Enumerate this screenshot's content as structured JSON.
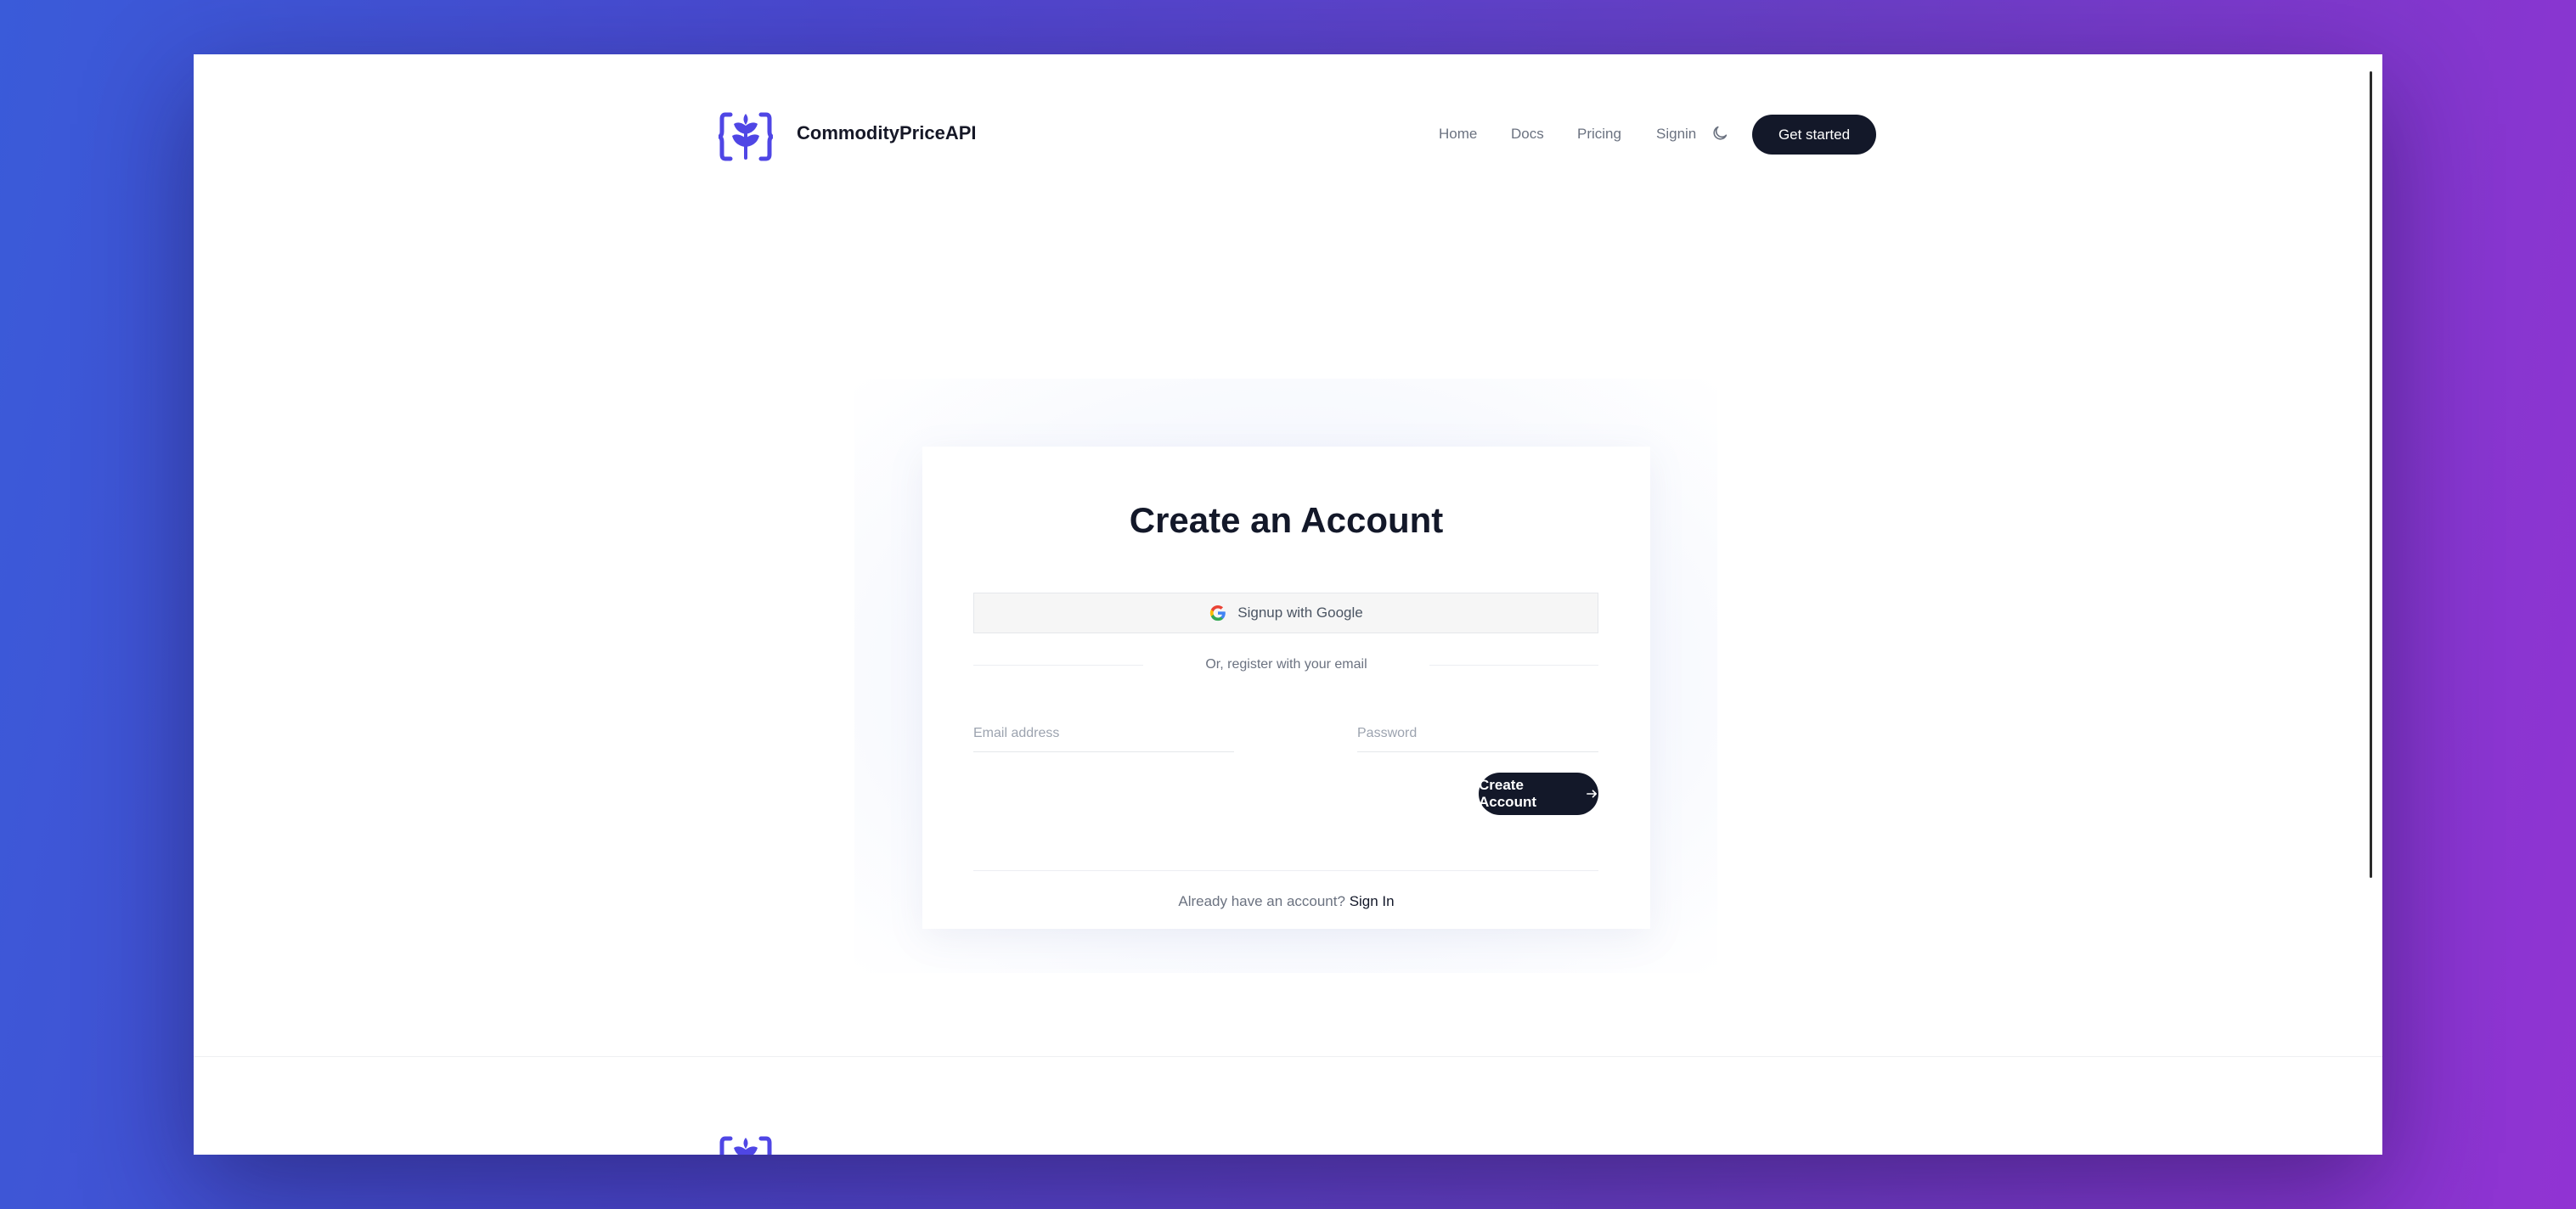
{
  "brand": {
    "name": "CommodityPriceAPI",
    "color": "#4f46e5"
  },
  "nav": {
    "items": [
      {
        "label": "Home"
      },
      {
        "label": "Docs"
      },
      {
        "label": "Pricing"
      },
      {
        "label": "Signin"
      }
    ],
    "theme_toggle_icon": "moon-icon",
    "cta_label": "Get started"
  },
  "form": {
    "title": "Create an Account",
    "google_label": "Signup with Google",
    "divider_text": "Or, register with your email",
    "email_placeholder": "Email address",
    "email_value": "",
    "password_placeholder": "Password",
    "password_value": "",
    "submit_label": "Create Account",
    "submit_icon": "arrow-right-icon",
    "signin_prompt": "Already have an account?",
    "signin_link": "Sign In"
  },
  "colors": {
    "primary_dark": "#131829",
    "accent": "#4f46e5",
    "background_gradient_start": "#3a5bd9",
    "background_gradient_end": "#9133d3"
  }
}
